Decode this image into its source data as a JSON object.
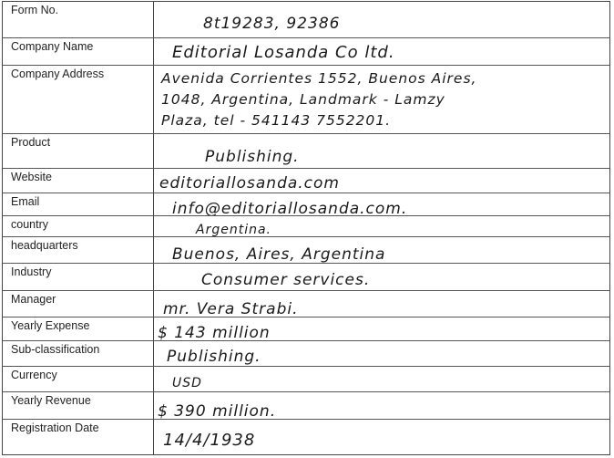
{
  "fields": [
    {
      "label": "Form No.",
      "value": [
        "8t19283, 92386"
      ]
    },
    {
      "label": "Company Name",
      "value": [
        "Editorial   Losanda     Co  ltd."
      ]
    },
    {
      "label": "Company Address",
      "value": [
        "Avenida Corrientes 1552, Buenos Aires,",
        "1048, Argentina, Landmark - Lamzy",
        "Plaza, tel - 541143 7552201."
      ]
    },
    {
      "label": "Product",
      "value": [
        "Publishing."
      ]
    },
    {
      "label": "Website",
      "value": [
        "editoriallosanda.com"
      ]
    },
    {
      "label": "Email",
      "value": [
        "info@editoriallosanda.com."
      ]
    },
    {
      "label": "country",
      "value": [
        "Argentina."
      ]
    },
    {
      "label": "headquarters",
      "value": [
        "Buenos, Aires, Argentina"
      ]
    },
    {
      "label": "Industry",
      "value": [
        "Consumer  services."
      ]
    },
    {
      "label": "Manager",
      "value": [
        "mr. Vera  Strabi."
      ]
    },
    {
      "label": "Yearly Expense",
      "value": [
        "$ 143  million"
      ]
    },
    {
      "label": "Sub-classification",
      "value": [
        "Publishing."
      ]
    },
    {
      "label": "Currency",
      "value": [
        "USD"
      ]
    },
    {
      "label": "Yearly Revenue",
      "value": [
        "$ 390  million."
      ]
    },
    {
      "label": "Registration Date",
      "value": [
        "14/4/1938"
      ]
    }
  ]
}
